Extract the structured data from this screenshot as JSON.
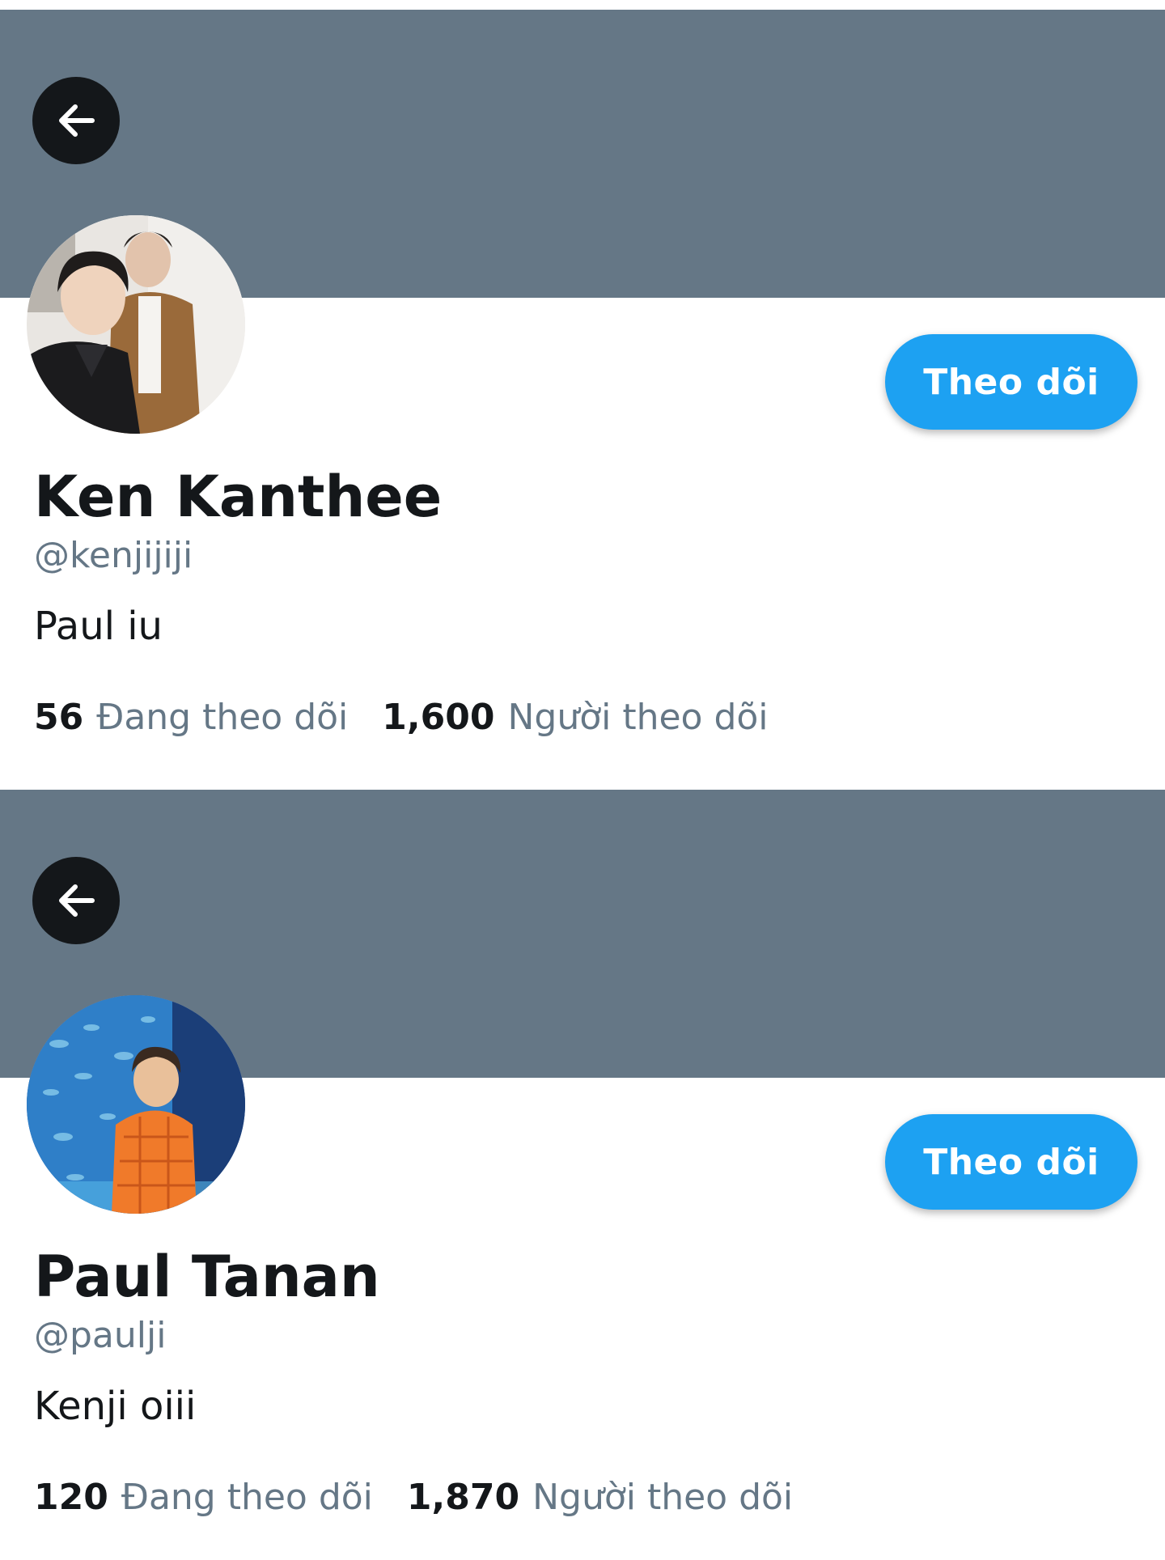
{
  "profiles": [
    {
      "display_name": "Ken Kanthee",
      "handle": "@kenjijiji",
      "bio": "Paul iu",
      "follow_label": "Theo dõi",
      "following_count": "56",
      "following_label": "Đang theo dõi",
      "followers_count": "1,600",
      "followers_label": "Người theo dõi",
      "avatar_description": "two-people-selfie-photo",
      "back_icon": "arrow-left-icon"
    },
    {
      "display_name": "Paul Tanan",
      "handle": "@paulji",
      "bio": "Kenji oiii",
      "follow_label": "Theo dõi",
      "following_count": "120",
      "following_label": "Đang theo dõi",
      "followers_count": "1,870",
      "followers_label": "Người theo dõi",
      "avatar_description": "aquarium-portrait-photo",
      "back_icon": "arrow-left-icon"
    }
  ],
  "colors": {
    "banner": "#657786",
    "accent": "#1da1f2",
    "primary_text": "#14171a",
    "secondary_text": "#657786"
  }
}
